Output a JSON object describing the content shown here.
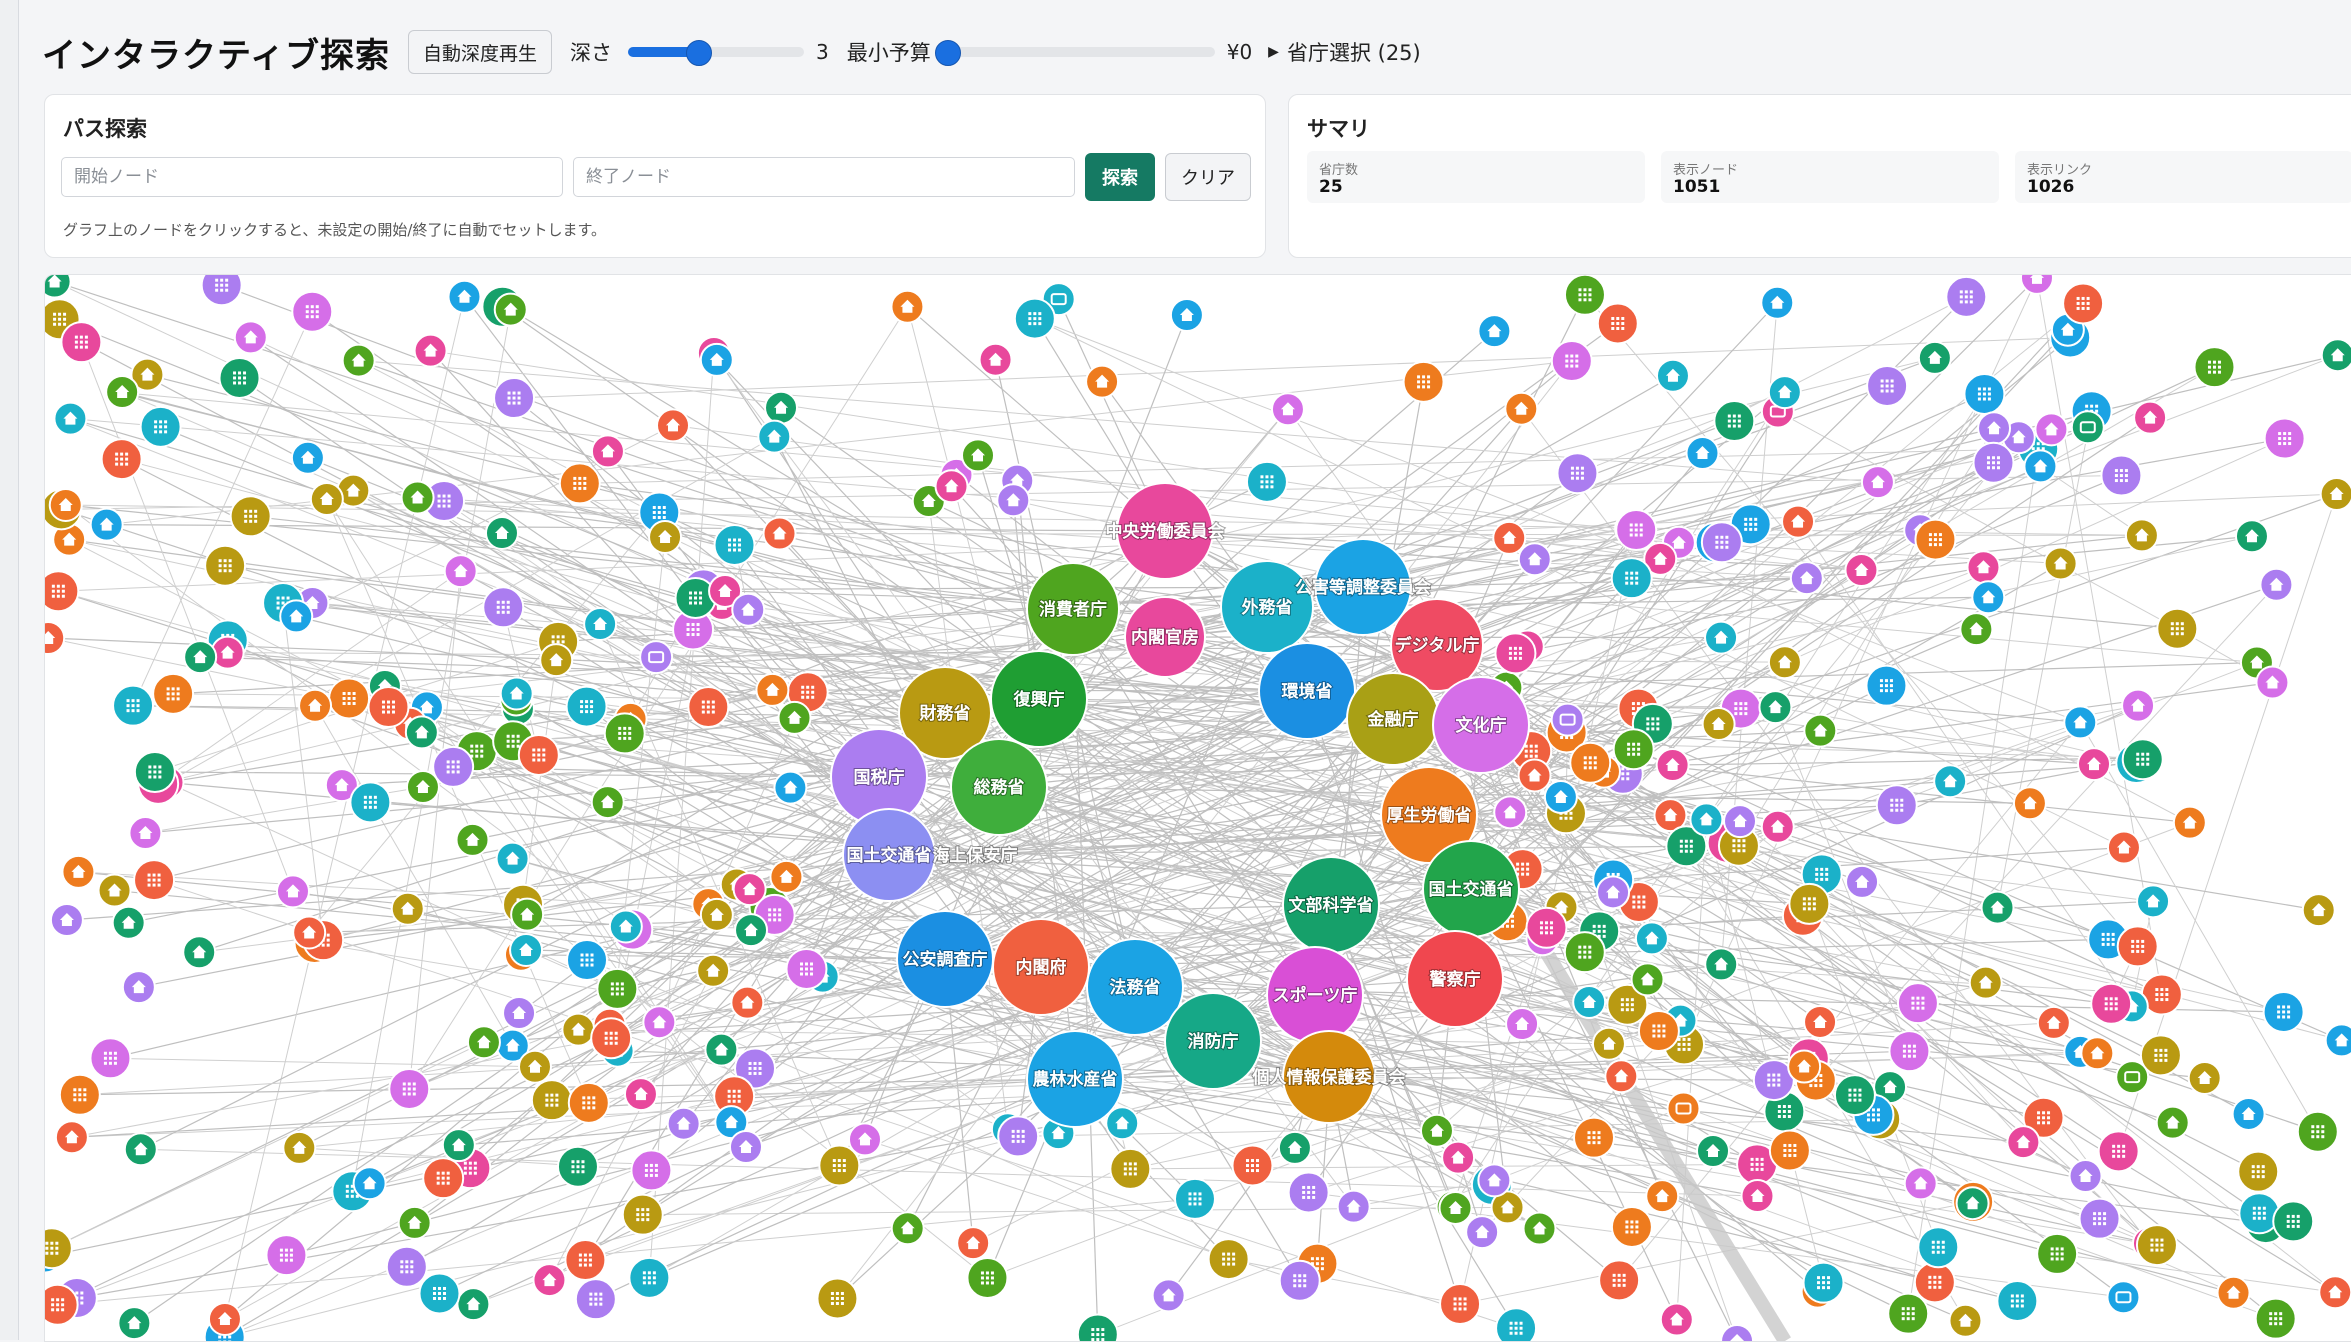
{
  "header": {
    "title": "インタラクティブ探索",
    "autoplay_label": "自動深度再生",
    "depth_label": "深さ",
    "depth_value": "3",
    "depth_fraction": 0.4,
    "budget_label": "最小予算",
    "budget_value": "¥0",
    "budget_fraction": 0.0,
    "agency_select_label": "省庁選択 (25)"
  },
  "path_panel": {
    "title": "パス探索",
    "start_placeholder": "開始ノード",
    "end_placeholder": "終了ノード",
    "search_label": "探索",
    "clear_label": "クリア",
    "hint": "グラフ上のノードをクリックすると、未設定の開始/終了に自動でセットします。"
  },
  "summary": {
    "title": "サマリ",
    "stats": [
      {
        "label": "省庁数",
        "value": "25"
      },
      {
        "label": "表示ノード",
        "value": "1051"
      },
      {
        "label": "表示リンク",
        "value": "1026"
      }
    ]
  },
  "graph": {
    "agency_nodes": [
      {
        "name": "中央労働委員会",
        "color": "#e8489c"
      },
      {
        "name": "消費者庁",
        "color": "#4fa51f"
      },
      {
        "name": "内閣官房",
        "color": "#e8489c"
      },
      {
        "name": "外務省",
        "color": "#1bb1c9"
      },
      {
        "name": "公害等調整委員会",
        "color": "#1ba3e4"
      },
      {
        "name": "デジタル庁",
        "color": "#ef4b63"
      },
      {
        "name": "財務省",
        "color": "#b99a12"
      },
      {
        "name": "復興庁",
        "color": "#1f9e33"
      },
      {
        "name": "環境省",
        "color": "#1b8fe2"
      },
      {
        "name": "金融庁",
        "color": "#a9a015"
      },
      {
        "name": "文化庁",
        "color": "#d56ee8"
      },
      {
        "name": "国税庁",
        "color": "#ab7df0"
      },
      {
        "name": "総務省",
        "color": "#3fae3c"
      },
      {
        "name": "厚生労働省",
        "color": "#ee7b1e"
      },
      {
        "name": "国土交通省",
        "color": "#8c8ff2"
      },
      {
        "name": "海上保安庁",
        "color": "#8c8ff2"
      },
      {
        "name": "国土交通省",
        "color": "#22a54b"
      },
      {
        "name": "文部科学省",
        "color": "#16a06a"
      },
      {
        "name": "公安調査庁",
        "color": "#1b8fe2"
      },
      {
        "name": "内閣府",
        "color": "#f0603f"
      },
      {
        "name": "法務省",
        "color": "#1ba3e4"
      },
      {
        "name": "スポーツ庁",
        "color": "#d94fd6"
      },
      {
        "name": "警察庁",
        "color": "#f0474f"
      },
      {
        "name": "消防庁",
        "color": "#16a887"
      },
      {
        "name": "農林水産省",
        "color": "#1ba3e4"
      },
      {
        "name": "個人情報保護委員会",
        "color": "#d48a0c"
      }
    ],
    "node_icons": [
      "home-icon",
      "grid-icon",
      "folder-icon"
    ],
    "palette": [
      "#ee7b1e",
      "#4fa51f",
      "#1ba3e4",
      "#e8489c",
      "#16a06a",
      "#d56ee8",
      "#b99a12",
      "#f0603f",
      "#1bb1c9",
      "#ab7df0"
    ]
  }
}
